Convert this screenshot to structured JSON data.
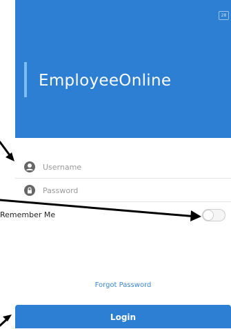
{
  "header": {
    "counter_badge": "28",
    "brand_title": "EmployeeOnline",
    "colors": {
      "background": "#2c7fd3",
      "accent_bar": "#7fbdf0"
    }
  },
  "form": {
    "username": {
      "placeholder": "Username",
      "value": "",
      "icon": "user-icon"
    },
    "password": {
      "placeholder": "Password",
      "value": "",
      "icon": "lock-icon"
    },
    "remember_me": {
      "label": "Remember Me",
      "checked": false
    },
    "forgot_password_label": "Forgot Password",
    "login_label": "Login"
  },
  "colors": {
    "primary": "#2c7fd3",
    "link": "#3a86cf",
    "annotation_arrow": "#000000"
  }
}
